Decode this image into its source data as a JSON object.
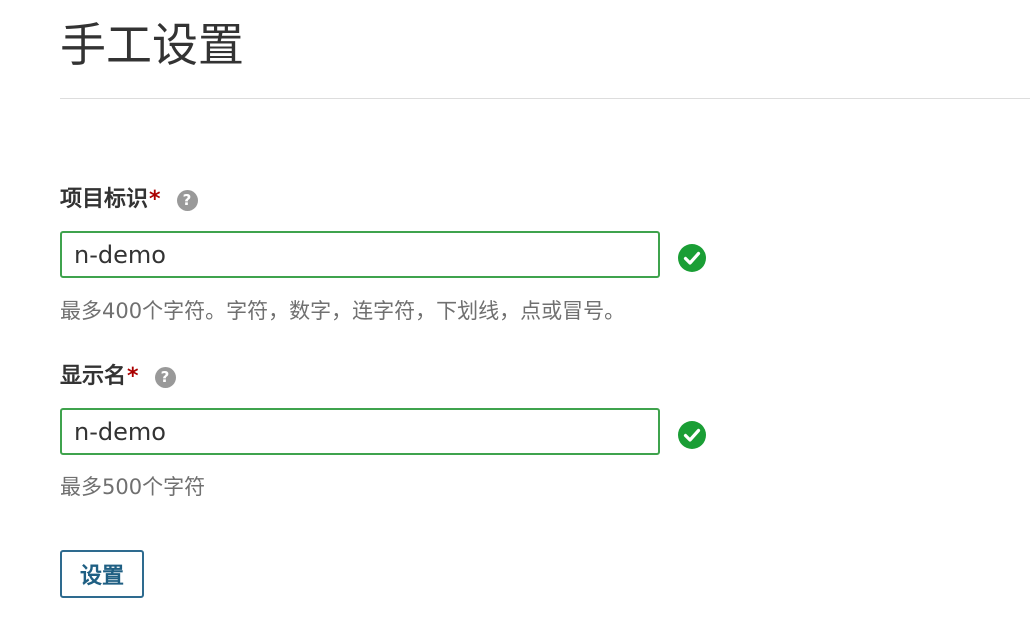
{
  "page": {
    "title": "手工设置"
  },
  "fields": {
    "project_id": {
      "label": "项目标识",
      "required_mark": "*",
      "help_icon": "?",
      "value": "n-demo",
      "hint": "最多400个字符。字符，数字，连字符，下划线，点或冒号。",
      "status_icon": "check-circle",
      "status_color": "#1a9e35"
    },
    "display_name": {
      "label": "显示名",
      "required_mark": "*",
      "help_icon": "?",
      "value": "n-demo",
      "hint": "最多500个字符",
      "status_icon": "check-circle",
      "status_color": "#1a9e35"
    }
  },
  "actions": {
    "submit_label": "设置"
  },
  "colors": {
    "valid_border": "#3fa34d",
    "required": "#aa0000",
    "button_text": "#1f5f83"
  }
}
